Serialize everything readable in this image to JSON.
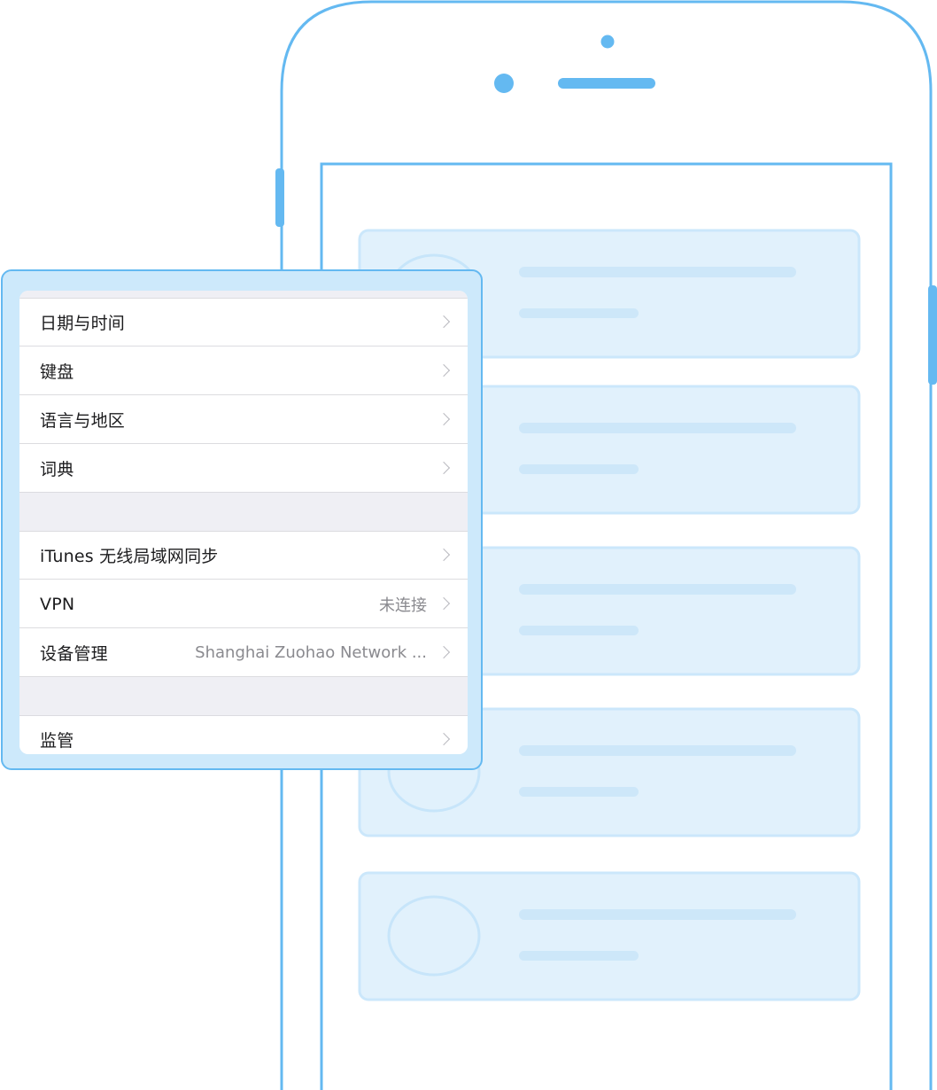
{
  "colors": {
    "phone_outline": "#64b9f1",
    "placeholder_card_fill": "#e1f1fc",
    "placeholder_card_border": "#cbe7fb",
    "placeholder_line": "#cde7f9",
    "settings_frame_bg": "#cde9fb",
    "separator": "#dcdce0",
    "group_gap": "#efeff4",
    "label_text": "#1c1c1e",
    "value_text": "#8a8a8f"
  },
  "settings": {
    "group1": [
      {
        "label": "日期与时间",
        "icon": "chevron-right-icon"
      },
      {
        "label": "键盘",
        "icon": "chevron-right-icon"
      },
      {
        "label": "语言与地区",
        "icon": "chevron-right-icon"
      },
      {
        "label": "词典",
        "icon": "chevron-right-icon"
      }
    ],
    "group2": [
      {
        "label": "iTunes 无线局域网同步",
        "value": "",
        "icon": "chevron-right-icon"
      },
      {
        "label": "VPN",
        "value": "未连接",
        "icon": "chevron-right-icon"
      },
      {
        "label": "设备管理",
        "value": "Shanghai Zuohao Network ...",
        "icon": "chevron-right-icon"
      }
    ],
    "group3": [
      {
        "label": "监管",
        "icon": "chevron-right-icon"
      }
    ]
  },
  "phone": {
    "placeholder_cards": 5,
    "icons": [
      "front-camera-icon",
      "proximity-sensor-icon",
      "earpiece-speaker-icon",
      "side-button-icon"
    ]
  }
}
